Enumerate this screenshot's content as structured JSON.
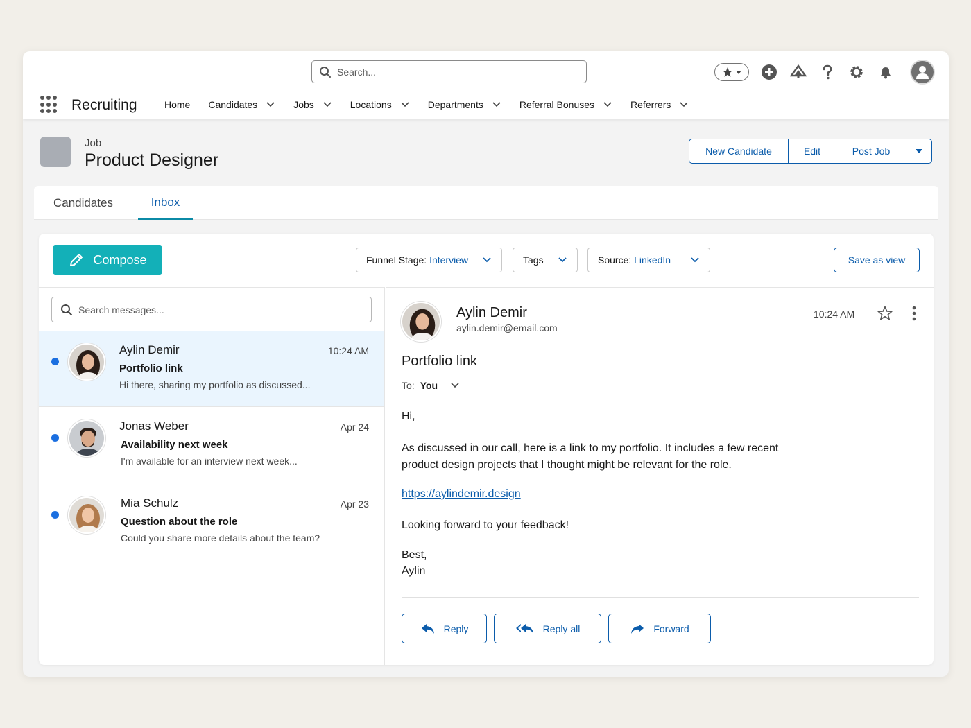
{
  "global": {
    "search_placeholder": "Search...",
    "icons": [
      "favorites-star-icon",
      "add-icon",
      "trailhead-icon",
      "help-icon",
      "setup-gear-icon",
      "notification-bell-icon",
      "user-avatar"
    ]
  },
  "app": {
    "name": "Recruiting",
    "nav": [
      {
        "label": "Home",
        "dropdown": false
      },
      {
        "label": "Candidates",
        "dropdown": true
      },
      {
        "label": "Jobs",
        "dropdown": true
      },
      {
        "label": "Locations",
        "dropdown": true
      },
      {
        "label": "Departments",
        "dropdown": true
      },
      {
        "label": "Referral Bonuses",
        "dropdown": true
      },
      {
        "label": "Referrers",
        "dropdown": true
      }
    ]
  },
  "record": {
    "type": "Job",
    "title": "Product Designer",
    "actions": {
      "new_candidate": "New Candidate",
      "edit": "Edit",
      "post_job": "Post Job"
    }
  },
  "tabs": [
    {
      "label": "Candidates",
      "active": false
    },
    {
      "label": "Inbox",
      "active": true
    }
  ],
  "toolbar": {
    "compose": "Compose",
    "filters": {
      "funnel_label": "Funnel Stage:",
      "funnel_value": "Interview",
      "tags_label": "Tags",
      "source_label": "Source:",
      "source_value": "LinkedIn"
    },
    "save_view": "Save as view"
  },
  "message_list": {
    "search_placeholder": "Search messages...",
    "items": [
      {
        "sender": "Aylin Demir",
        "date": "10:24 AM",
        "subject": "Portfolio link",
        "preview": "Hi there, sharing my portfolio as discussed...",
        "unread": true,
        "selected": true
      },
      {
        "sender": "Jonas Weber",
        "date": "Apr 24",
        "subject": "Availability next week",
        "preview": "I'm available for an interview next week...",
        "unread": true,
        "selected": false
      },
      {
        "sender": "Mia Schulz",
        "date": "Apr 23",
        "subject": "Question about the role",
        "preview": "Could you share more details about the team?",
        "unread": true,
        "selected": false
      }
    ]
  },
  "reader": {
    "sender_name": "Aylin Demir",
    "sender_email": "aylin.demir@email.com",
    "time": "10:24 AM",
    "subject": "Portfolio link",
    "to_label": "To:",
    "to_value": "You",
    "greeting": "Hi,",
    "para1_line1": "As discussed in our call, here is a link to my portfolio. It includes a few recent",
    "para1_line2": "product design projects that I thought might be relevant for the role.",
    "link": "https://aylindemir.design",
    "closing": "Looking forward to your feedback!",
    "signoff": "Best,",
    "signature": "Aylin",
    "actions": {
      "reply": "Reply",
      "reply_all": "Reply all",
      "forward": "Forward"
    }
  },
  "colors": {
    "brand_blue": "#0b5cab",
    "compose_teal": "#13b0b8",
    "unread_dot": "#1b6fe0",
    "selected_row": "#eaf5fe"
  }
}
